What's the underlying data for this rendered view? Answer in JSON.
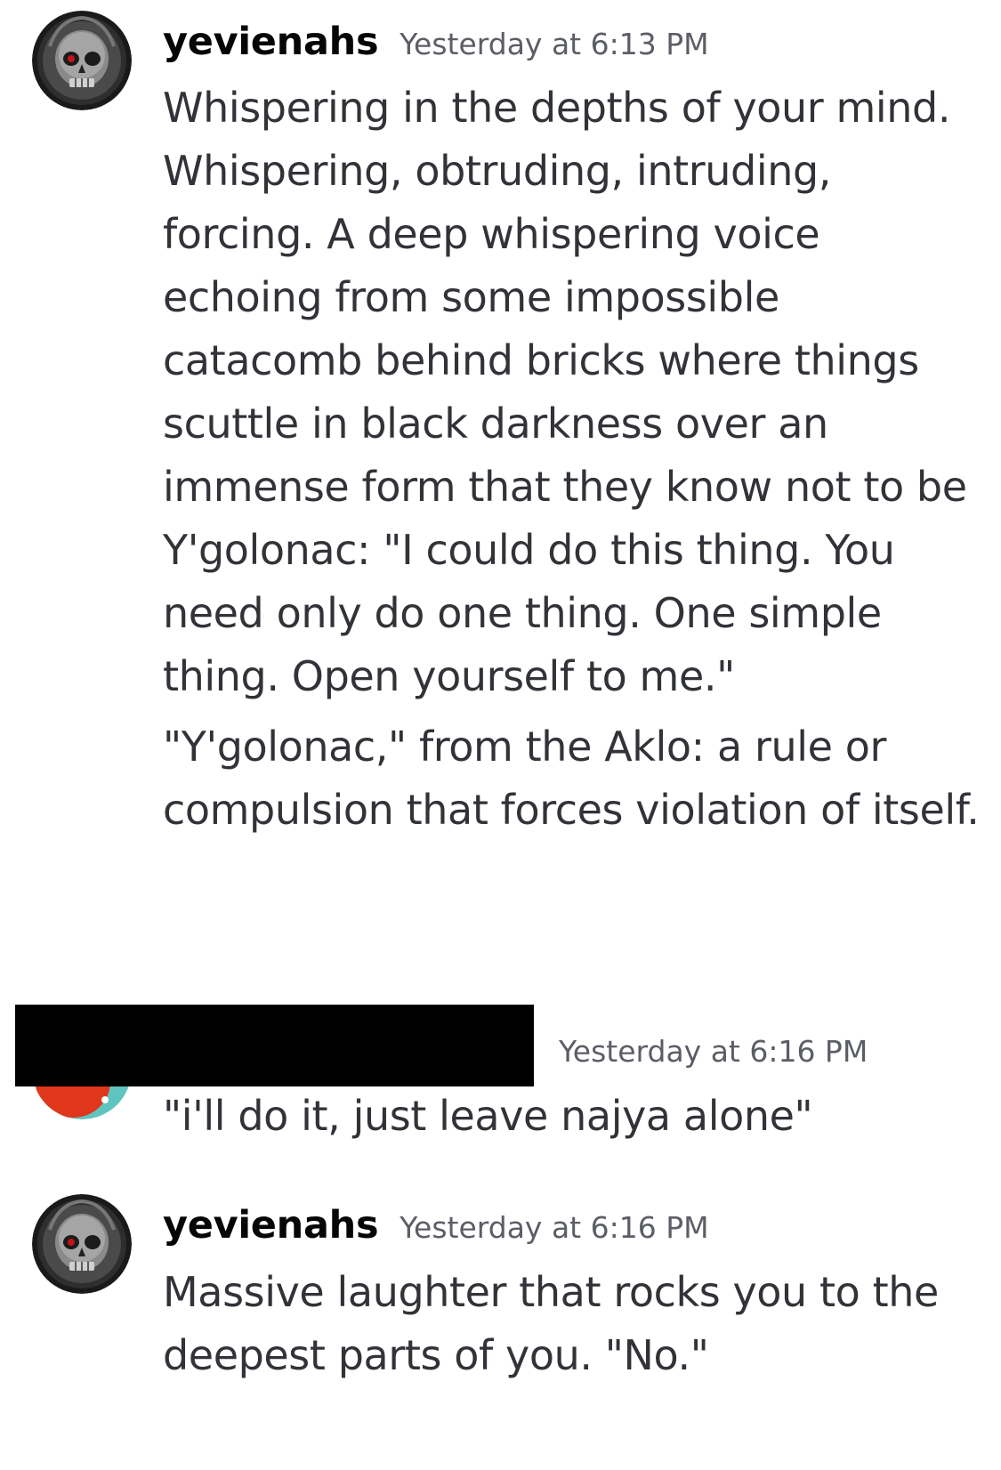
{
  "messages": [
    {
      "username": "yevienahs",
      "timestamp": "Yesterday at 6:13 PM",
      "avatar_icon": "skull-avatar-icon",
      "paragraphs": [
        "Whispering in the depths of your mind. Whispering, obtruding, intruding, forcing. A deep whispering voice echoing from some impossible catacomb behind bricks where things scuttle in black darkness over an immense form that they know not to be Y'golonac: \"I could do this thing. You need only do one thing. One simple thing. Open yourself to me.\"",
        "\"Y'golonac,\" from the Aklo: a rule or compulsion that forces violation of itself."
      ]
    },
    {
      "username": "",
      "timestamp": "Yesterday at 6:16 PM",
      "avatar_icon": "red-character-avatar-icon",
      "paragraphs": [
        "\"i'll do it, just leave najya alone\""
      ]
    },
    {
      "username": "yevienahs",
      "timestamp": "Yesterday at 6:16 PM",
      "avatar_icon": "skull-avatar-icon",
      "paragraphs": [
        "Massive laughter that rocks you to the deepest parts of you. \"No.\""
      ]
    }
  ],
  "colors": {
    "background": "#ffffff",
    "username": "#060607",
    "text": "#313338",
    "timestamp": "#5c5e66",
    "redaction": "#000000"
  }
}
